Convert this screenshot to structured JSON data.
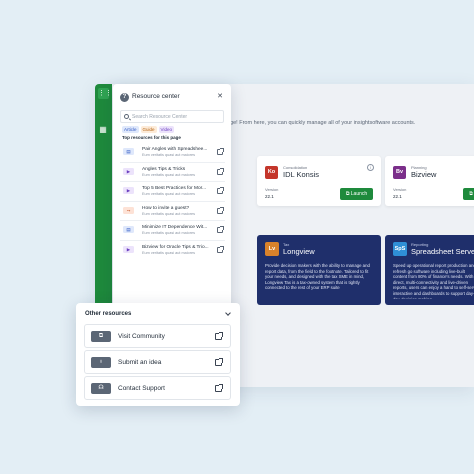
{
  "app": {
    "intro": "age! From here, you can quickly manage all of your insightsoftware accounts.",
    "rail": {
      "grid_icon": "grid-icon",
      "tile_icon": "tiles-icon"
    },
    "cards": [
      {
        "badge": "Ko",
        "badge_color": "#c4362b",
        "category": "Consolidation",
        "name": "IDL Konsis",
        "version_label": "Version",
        "version": "22.1",
        "launch": "Launch"
      },
      {
        "badge": "Bv",
        "badge_color": "#7b2f8a",
        "category": "Planning",
        "name": "Bizview",
        "version_label": "Version",
        "version": "22.1",
        "launch": "Launch"
      }
    ],
    "partial_card": {
      "version_label": "Version",
      "version": "22.1"
    },
    "dark_cards": [
      {
        "badge": "Lv",
        "badge_color": "#d9822b",
        "category": "Tax",
        "name": "Longview",
        "description": "Provide decision makers with the ability to manage and report data, from the field to the footnote. Tailored to fit your needs, and designed with the tax SME in mind, Longview Tax is a tax-owned system that is tightly connected to the rest of your ERP suite"
      },
      {
        "badge": "SpS",
        "badge_color": "#2f8fd6",
        "category": "Reporting",
        "name": "Spreadsheet Server",
        "description": "Speed up operational report production and refresh go software including live-built content from 80% of finance's needs. With direct, multi-connectivity and live-driven reports, users can enjoy a hand to self-serve interactive and dashboards to support day-to-day decision making"
      }
    ],
    "partial_dark": {
      "description": "data-driven"
    }
  },
  "resource_center": {
    "title": "Resource center",
    "search_placeholder": "Search Resource Center",
    "chips": [
      "Article",
      "Guide",
      "Video"
    ],
    "top_label": "Top resources for this page",
    "items": [
      {
        "title": "Pair Angles with Spreadshee...",
        "subtitle": "Eum veritatis quasi aut maiores",
        "type_icon": "document-icon",
        "type_color": "#dfe8fb",
        "type_fg": "#2e56c2"
      },
      {
        "title": "Angles Tips & Tricks",
        "subtitle": "Eum veritatis quasi aut maiores",
        "type_icon": "video-icon",
        "type_color": "#ece3fb",
        "type_fg": "#6b3fc0"
      },
      {
        "title": "Top 5 Best Practices for Mor...",
        "subtitle": "Eum veritatis quasi aut maiores",
        "type_icon": "video-icon",
        "type_color": "#ece3fb",
        "type_fg": "#6b3fc0"
      },
      {
        "title": "How to invite a guest?",
        "subtitle": "Eum veritatis quasi aut maiores",
        "type_icon": "guide-icon",
        "type_color": "#fde2d6",
        "type_fg": "#c4501d"
      },
      {
        "title": "Minimize IT Dependence Wit...",
        "subtitle": "Eum veritatis quasi aut maiores",
        "type_icon": "document-icon",
        "type_color": "#dfe8fb",
        "type_fg": "#2e56c2"
      },
      {
        "title": "Bizview for Oracle Tips & Trio...",
        "subtitle": "Eum veritatis quasi aut maiores",
        "type_icon": "video-icon",
        "type_color": "#ece3fb",
        "type_fg": "#6b3fc0"
      }
    ]
  },
  "other_resources": {
    "title": "Other resources",
    "items": [
      {
        "label": "Visit Community",
        "icon": "community-icon"
      },
      {
        "label": "Submit an idea",
        "icon": "lightbulb-icon"
      },
      {
        "label": "Contact Support",
        "icon": "headset-icon"
      }
    ]
  }
}
